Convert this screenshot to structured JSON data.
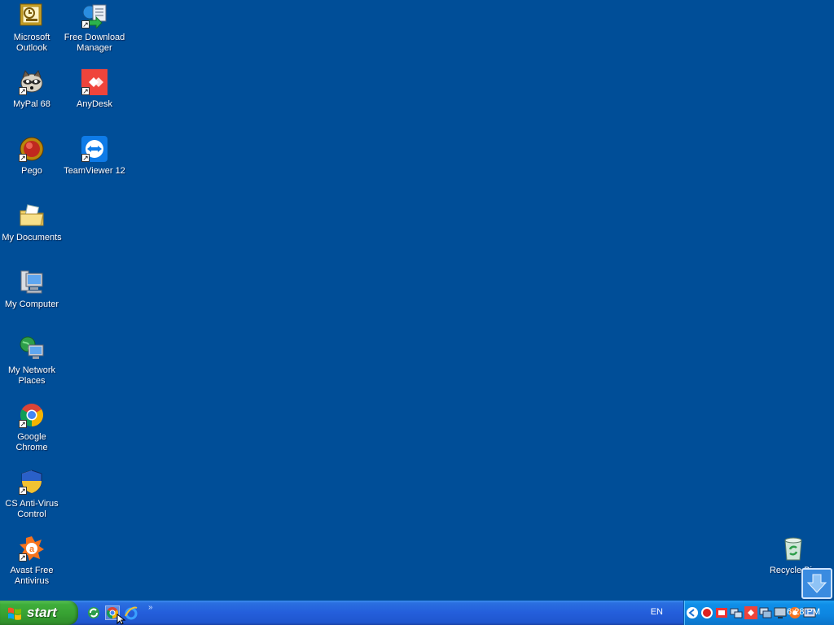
{
  "desktop": {
    "icons": {
      "outlook": "Microsoft Outlook",
      "fdm": "Free Download Manager",
      "mypal": "MyPal 68",
      "anydesk": "AnyDesk",
      "pego": "Pego",
      "teamviewer": "TeamViewer 12",
      "mydocs": "My Documents",
      "mycomputer": "My Computer",
      "network": "My Network Places",
      "chrome": "Google Chrome",
      "csav": "CS Anti-Virus Control",
      "avast": "Avast Free Antivirus",
      "recycle": "Recycle Bin"
    }
  },
  "taskbar": {
    "start_label": "start",
    "more_chevron": "»",
    "language": "EN",
    "clock": "6:28 PM"
  },
  "colors": {
    "desktop": "#004e98",
    "taskbar": "#245edb",
    "start": "#37a132",
    "tray": "#0d85e0"
  }
}
